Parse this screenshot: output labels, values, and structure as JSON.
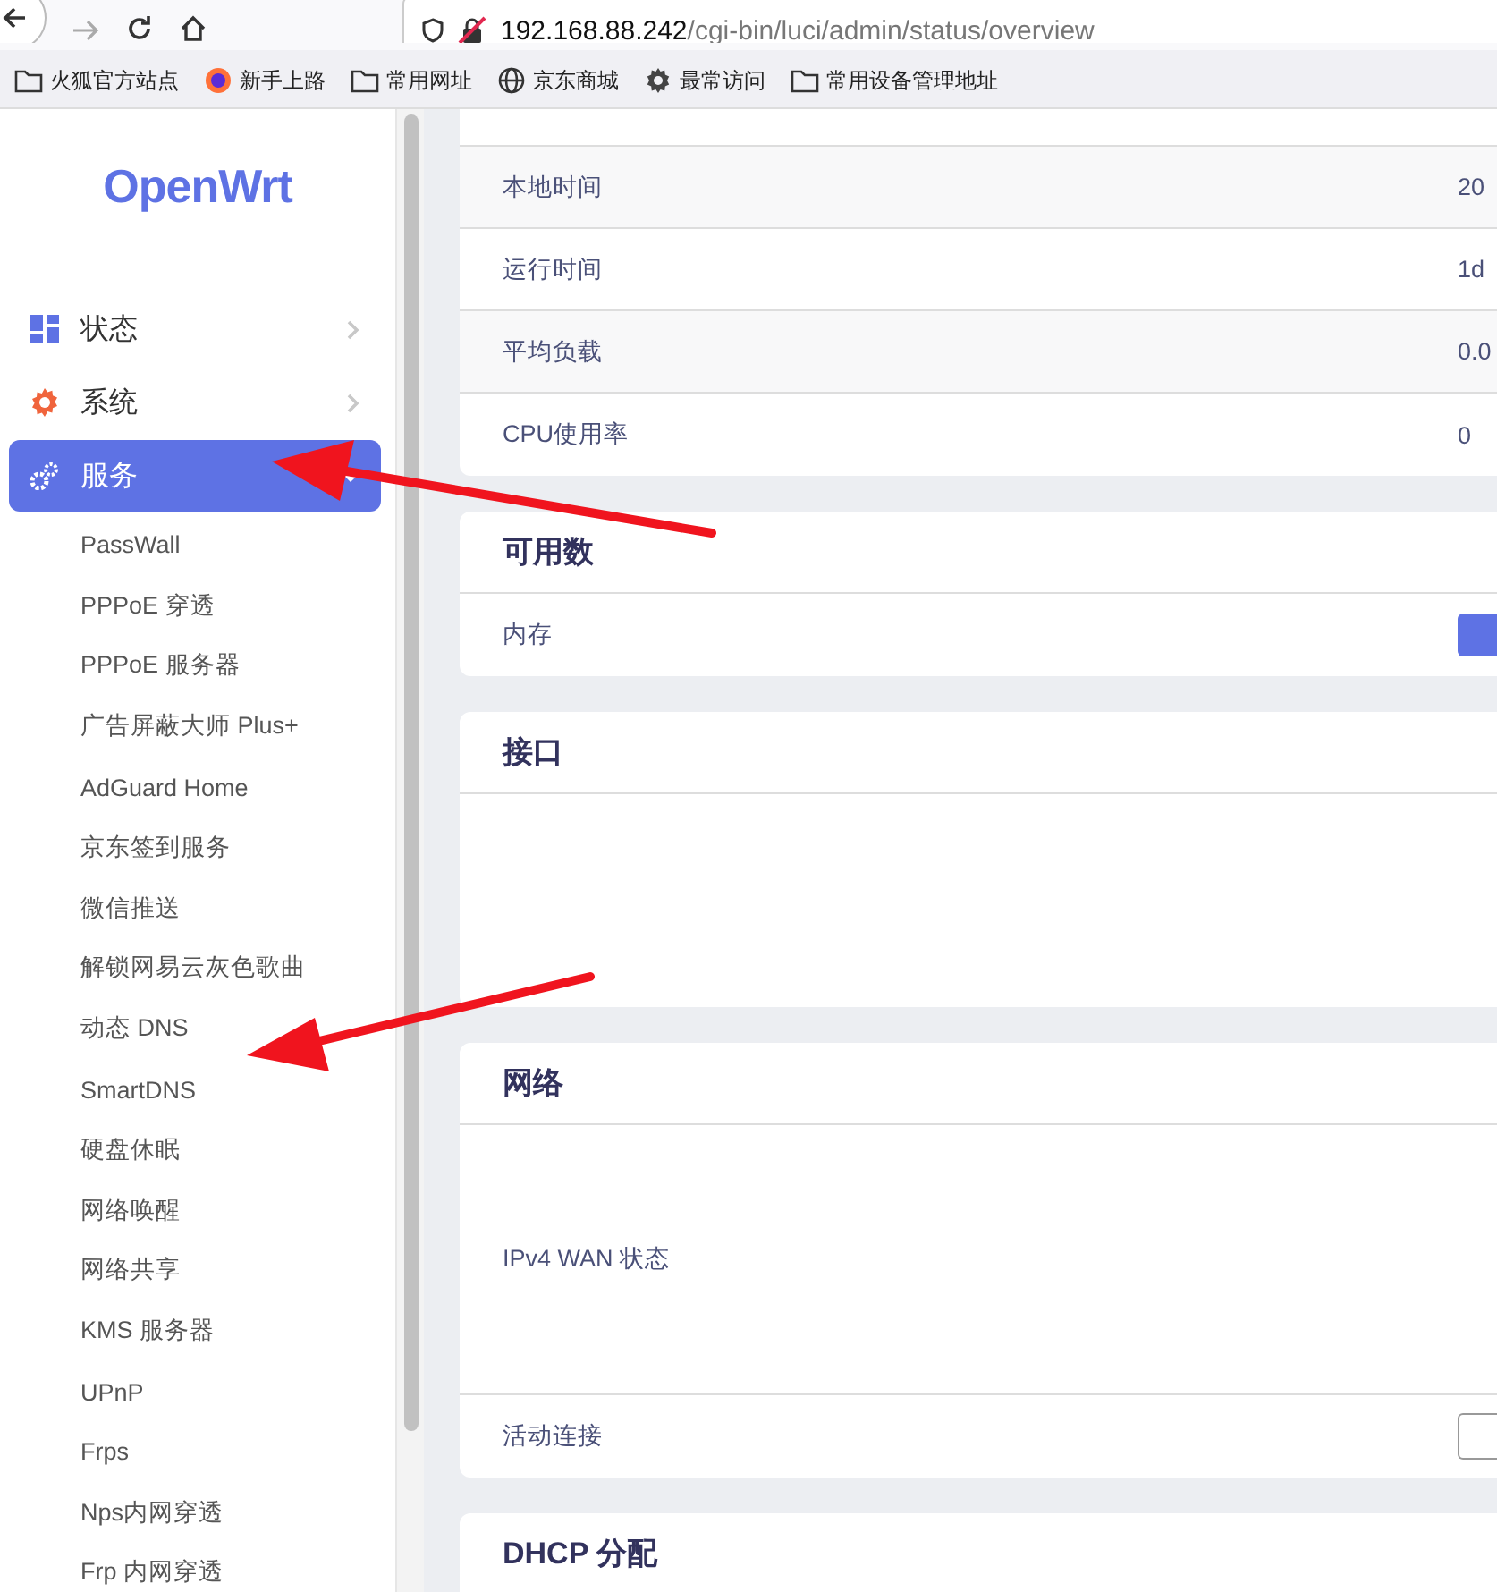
{
  "browser": {
    "url_host": "192.168.88.242",
    "url_path": "/cgi-bin/luci/admin/status/overview",
    "bookmarks": [
      {
        "label": "火狐官方站点",
        "kind": "folder"
      },
      {
        "label": "新手上路",
        "kind": "site"
      },
      {
        "label": "常用网址",
        "kind": "folder"
      },
      {
        "label": "京东商城",
        "kind": "page"
      },
      {
        "label": "最常访问",
        "kind": "smart"
      },
      {
        "label": "常用设备管理地址",
        "kind": "folder"
      }
    ]
  },
  "sidebar": {
    "logo": "OpenWrt",
    "items": [
      {
        "label": "状态",
        "selected": false,
        "expanded": false
      },
      {
        "label": "系统",
        "selected": false,
        "expanded": false
      },
      {
        "label": "服务",
        "selected": true,
        "expanded": true,
        "children": [
          {
            "label": "PassWall"
          },
          {
            "label": "PPPoE 穿透"
          },
          {
            "label": "PPPoE 服务器"
          },
          {
            "label": "广告屏蔽大师 Plus+"
          },
          {
            "label": "AdGuard Home"
          },
          {
            "label": "京东签到服务"
          },
          {
            "label": "微信推送"
          },
          {
            "label": "解锁网易云灰色歌曲"
          },
          {
            "label": "动态 DNS"
          },
          {
            "label": "SmartDNS"
          },
          {
            "label": "硬盘休眠"
          },
          {
            "label": "网络唤醒"
          },
          {
            "label": "网络共享"
          },
          {
            "label": "KMS 服务器"
          },
          {
            "label": "UPnP"
          },
          {
            "label": "Frps"
          },
          {
            "label": "Nps内网穿透"
          },
          {
            "label": "Frp 内网穿透"
          }
        ]
      }
    ]
  },
  "sections": [
    {
      "rows": [
        {
          "label": "本地时间",
          "kind": "text",
          "value": "20"
        },
        {
          "label": "运行时间",
          "kind": "text",
          "value": "1d"
        },
        {
          "label": "平均负载",
          "kind": "text",
          "value": "0.0"
        },
        {
          "label": "CPU使用率",
          "kind": "text",
          "value": "0"
        }
      ]
    },
    {
      "title": "可用数",
      "rows": [
        {
          "label": "内存",
          "kind": "bar"
        }
      ]
    },
    {
      "title": "接口"
    },
    {
      "title": "网络",
      "rows": [
        {
          "label": "IPv4 WAN 状态",
          "kind": "tall"
        },
        {
          "label": "活动连接",
          "kind": "field"
        }
      ]
    },
    {
      "title": "DHCP 分配"
    }
  ]
}
